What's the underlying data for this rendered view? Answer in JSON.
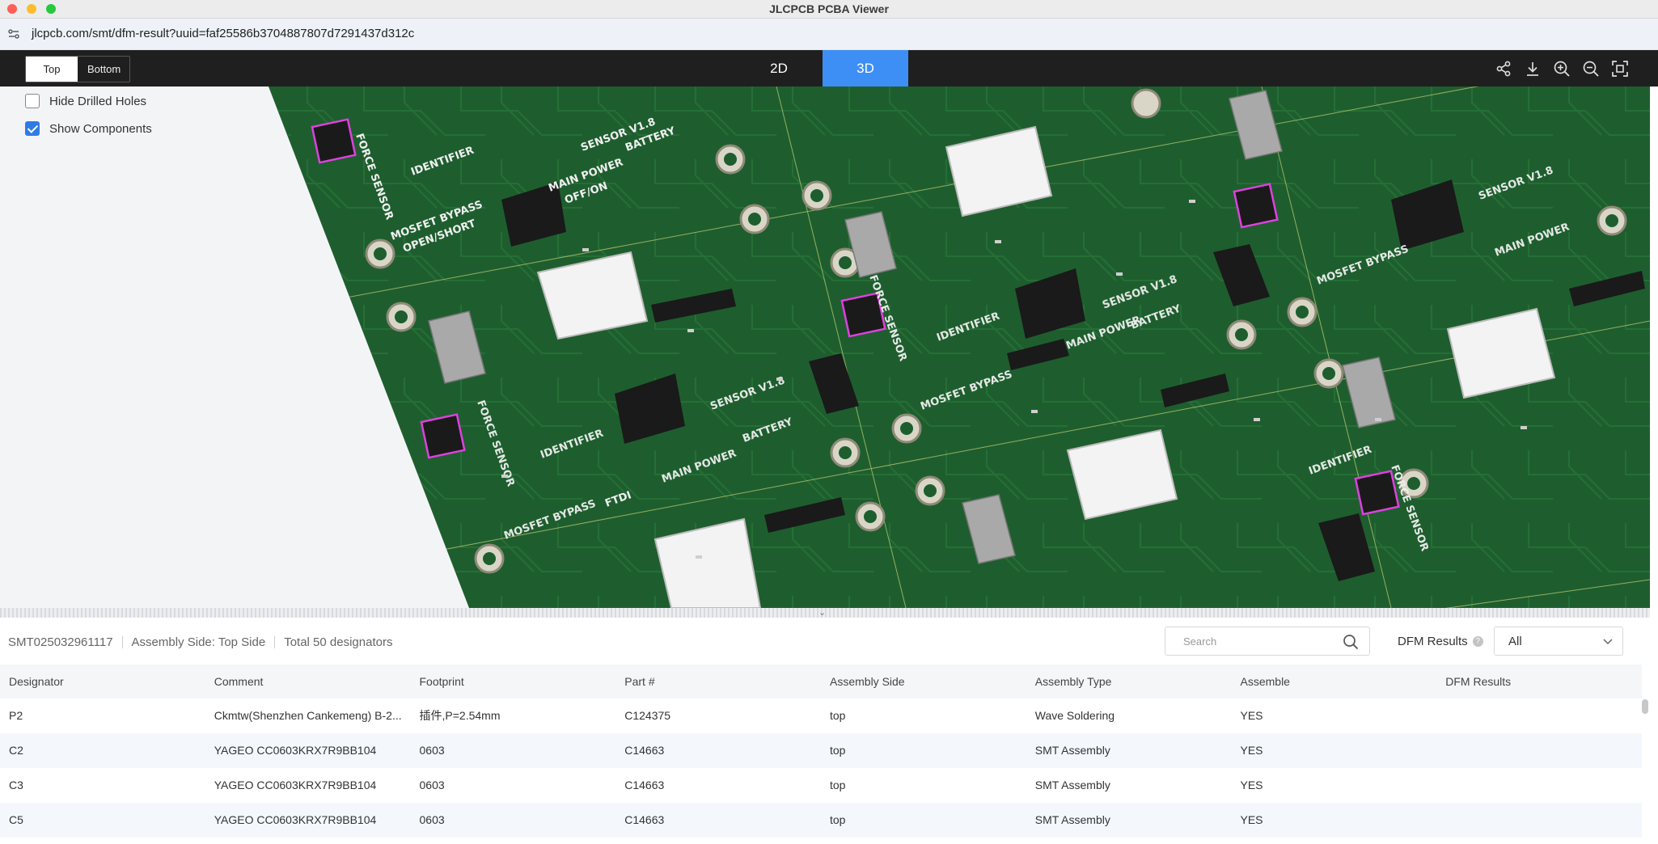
{
  "window": {
    "title": "JLCPCB PCBA Viewer"
  },
  "url": {
    "text": "jlcpcb.com/smt/dfm-result?uuid=faf25586b3704887807d7291437d312c"
  },
  "toolbar": {
    "side_top": "Top",
    "side_bottom": "Bottom",
    "tab_2d": "2D",
    "tab_3d": "3D",
    "icons": [
      "share-icon",
      "download-icon",
      "zoom-in-icon",
      "zoom-out-icon",
      "fit-screen-icon"
    ]
  },
  "viewer": {
    "hide_drilled_holes": {
      "label": "Hide Drilled Holes",
      "checked": false
    },
    "show_components": {
      "label": "Show Components",
      "checked": true
    },
    "board_labels": {
      "sensor": "SENSOR V1.8",
      "identifier": "IDENTIFIER",
      "force": "FORCE SENSOR",
      "bypass_1": "MOSFET BYPASS",
      "bypass_2": "OPEN/SHORT",
      "power_1": "MAIN POWER",
      "power_2": "OFF/ON",
      "battery": "BATTERY",
      "ftdi": "FTDI"
    }
  },
  "info": {
    "order_id": "SMT025032961117",
    "assembly_side": "Assembly Side: Top Side",
    "total": "Total 50 designators"
  },
  "search": {
    "placeholder": "Search"
  },
  "dfm_filter": {
    "label": "DFM Results",
    "value": "All"
  },
  "table": {
    "columns": [
      "Designator",
      "Comment",
      "Footprint",
      "Part #",
      "Assembly Side",
      "Assembly Type",
      "Assemble",
      "DFM Results"
    ],
    "rows": [
      [
        "P2",
        "Ckmtw(Shenzhen Cankemeng) B-2...",
        "插件,P=2.54mm",
        "C124375",
        "top",
        "Wave Soldering",
        "YES",
        ""
      ],
      [
        "C2",
        "YAGEO CC0603KRX7R9BB104",
        "0603",
        "C14663",
        "top",
        "SMT Assembly",
        "YES",
        ""
      ],
      [
        "C3",
        "YAGEO CC0603KRX7R9BB104",
        "0603",
        "C14663",
        "top",
        "SMT Assembly",
        "YES",
        ""
      ],
      [
        "C5",
        "YAGEO CC0603KRX7R9BB104",
        "0603",
        "C14663",
        "top",
        "SMT Assembly",
        "YES",
        ""
      ]
    ]
  },
  "colors": {
    "accent": "#3d8ef5",
    "pcb_green": "#1e5e2e",
    "toolbar_bg": "#1f1f1f"
  }
}
